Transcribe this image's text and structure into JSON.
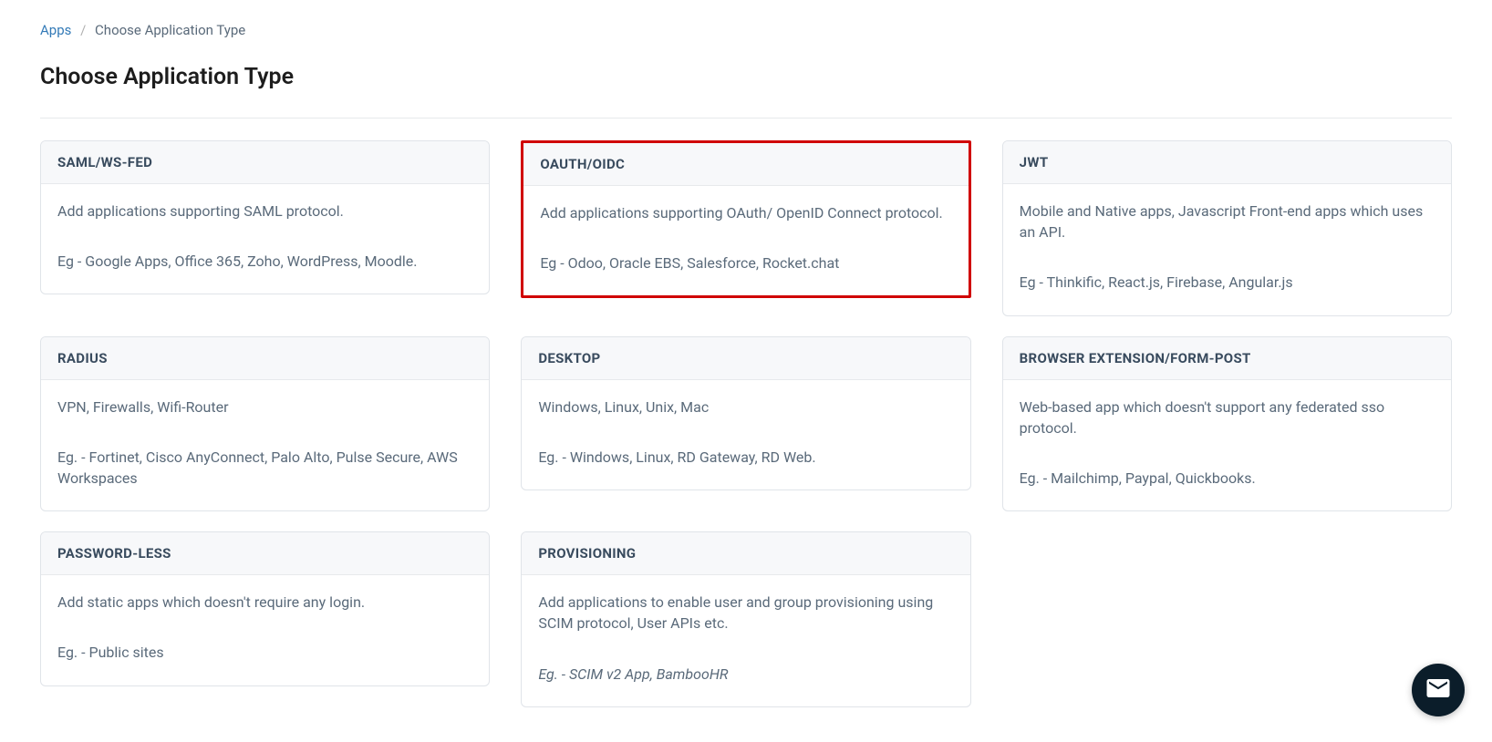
{
  "breadcrumb": {
    "parent": "Apps",
    "current": "Choose Application Type"
  },
  "page_title": "Choose Application Type",
  "cards": [
    {
      "title": "SAML/WS-FED",
      "desc": "Add applications supporting SAML protocol.",
      "example": "Eg - Google Apps, Office 365, Zoho, WordPress, Moodle.",
      "highlighted": false,
      "italic_example": false
    },
    {
      "title": "OAUTH/OIDC",
      "desc": "Add applications supporting OAuth/ OpenID Connect protocol.",
      "example": "Eg - Odoo, Oracle EBS, Salesforce, Rocket.chat",
      "highlighted": true,
      "italic_example": false
    },
    {
      "title": "JWT",
      "desc": "Mobile and Native apps, Javascript Front-end apps which uses an API.",
      "example": "Eg - Thinkific, React.js, Firebase, Angular.js",
      "highlighted": false,
      "italic_example": false
    },
    {
      "title": "RADIUS",
      "desc": "VPN, Firewalls, Wifi-Router",
      "example": "Eg. - Fortinet, Cisco AnyConnect, Palo Alto, Pulse Secure, AWS Workspaces",
      "highlighted": false,
      "italic_example": false
    },
    {
      "title": "DESKTOP",
      "desc": "Windows, Linux, Unix, Mac",
      "example": "Eg. - Windows, Linux, RD Gateway, RD Web.",
      "highlighted": false,
      "italic_example": false
    },
    {
      "title": "BROWSER EXTENSION/FORM-POST",
      "desc": "Web-based app which doesn't support any federated sso protocol.",
      "example": "Eg. - Mailchimp, Paypal, Quickbooks.",
      "highlighted": false,
      "italic_example": false
    },
    {
      "title": "PASSWORD-LESS",
      "desc": "Add static apps which doesn't require any login.",
      "example": "Eg. - Public sites",
      "highlighted": false,
      "italic_example": false
    },
    {
      "title": "PROVISIONING",
      "desc": "Add applications to enable user and group provisioning using SCIM protocol, User APIs etc.",
      "example": "Eg. - SCIM v2 App, BambooHR",
      "highlighted": false,
      "italic_example": true
    }
  ]
}
